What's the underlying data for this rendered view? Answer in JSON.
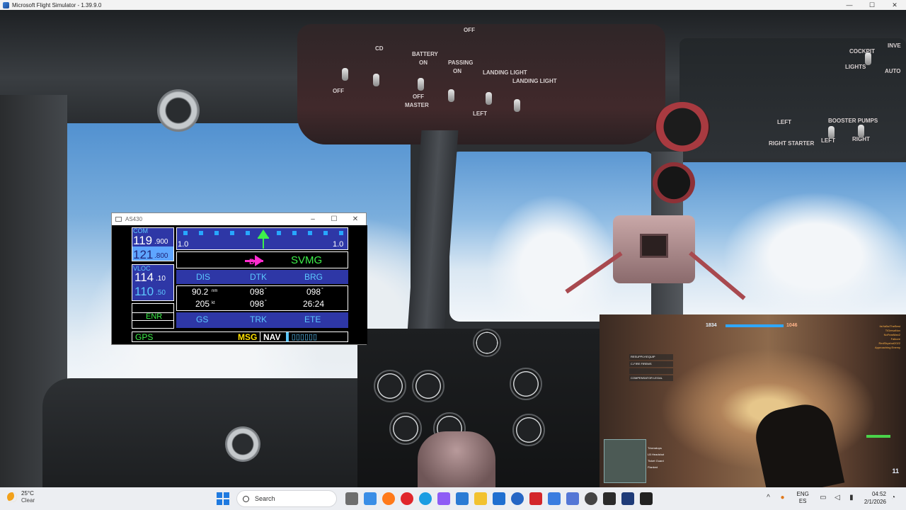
{
  "window": {
    "title": "Microsoft Flight Simulator - 1.39.9.0",
    "minimize": "—",
    "maximize": "☐",
    "close": "✕"
  },
  "cockpit_labels": {
    "cd": "CD",
    "off_top": "OFF",
    "battery": "BATTERY",
    "on1": "ON",
    "off1": "OFF",
    "master": "MASTER",
    "passing": "PASSING",
    "on2": "ON",
    "off_light": "OFF\nLIGHT",
    "landing_light": "LANDING\nLIGHT",
    "landing_light2": "LANDING\nLIGHT",
    "off_left": "OFF",
    "left": "LEFT",
    "right": "RIGHT",
    "cockpit": "COCKPIT",
    "lights": "LIGHTS",
    "on_r": "ON",
    "off_r": "OFF",
    "inverter": "INVE",
    "auto": "AUTO",
    "booster_pumps": "BOOSTER PUMPS",
    "left2": "LEFT",
    "right2": "RIGHT",
    "left3": "LEFT",
    "right_starter": "RIGHT\nSTARTER",
    "off_cd": "OFF"
  },
  "as430": {
    "title": "AS430",
    "com_label": "COM",
    "com_active_main": "119",
    "com_active_frac": ".900",
    "com_standby_main": "121",
    "com_standby_frac": ".800",
    "vloc_label": "VLOC",
    "vloc_active_main": "114",
    "vloc_active_frac": ".10",
    "vloc_standby_main": "110",
    "vloc_standby_frac": ".50",
    "mode": "ENR",
    "cdi_left": "1.0",
    "cdi_right": "1.0",
    "waypoint": "SVMG",
    "h_dis": "DIS",
    "h_dtk": "DTK",
    "h_brg": "BRG",
    "dis_value": "90.2",
    "dis_unit": "nm",
    "dtk_value": "098",
    "dtk_unit": "°",
    "brg_value": "098",
    "brg_unit": "°",
    "gs_value": "205",
    "gs_unit": "kt",
    "trk_value": "098",
    "trk_unit": "°",
    "ete_value": "26:24",
    "h_gs": "GS",
    "h_trk": "TRK",
    "h_ete": "ETE",
    "gps_label": "GPS",
    "msg_label": "MSG",
    "nav_label": "NAV",
    "nav_bar": "▌▯▯▯▯▯▯"
  },
  "bf_overlay": {
    "score_left": "1834",
    "score_right": "1046",
    "menu": [
      "RESUPPLY/EQUIP",
      "C-FIRE FIREMS",
      "",
      "COMPENSATOR LEGAL"
    ],
    "kills": [
      "Triceratops",
      "LB Headshot",
      "Ticket Guard",
      "Flanked"
    ],
    "ammo": "11",
    "squad": [
      "ItsYaBoiTheBest",
      "TiGresaNox",
      "NoFearMan2",
      "Falkore",
      "RedSkyshot2022",
      "Approaching Enemy"
    ]
  },
  "taskbar": {
    "temp": "25°C",
    "condition": "Clear",
    "search": "Search",
    "lang_top": "ENG",
    "lang_bottom": "ES",
    "time": "04:52",
    "date": "2/1/2026"
  },
  "colors": {
    "gps_blue": "#2e37a6",
    "gps_cyan": "#5cc8ff",
    "gps_green": "#3df04a",
    "gps_magenta": "#ff2ccf",
    "gps_yellow": "#ffe100"
  }
}
